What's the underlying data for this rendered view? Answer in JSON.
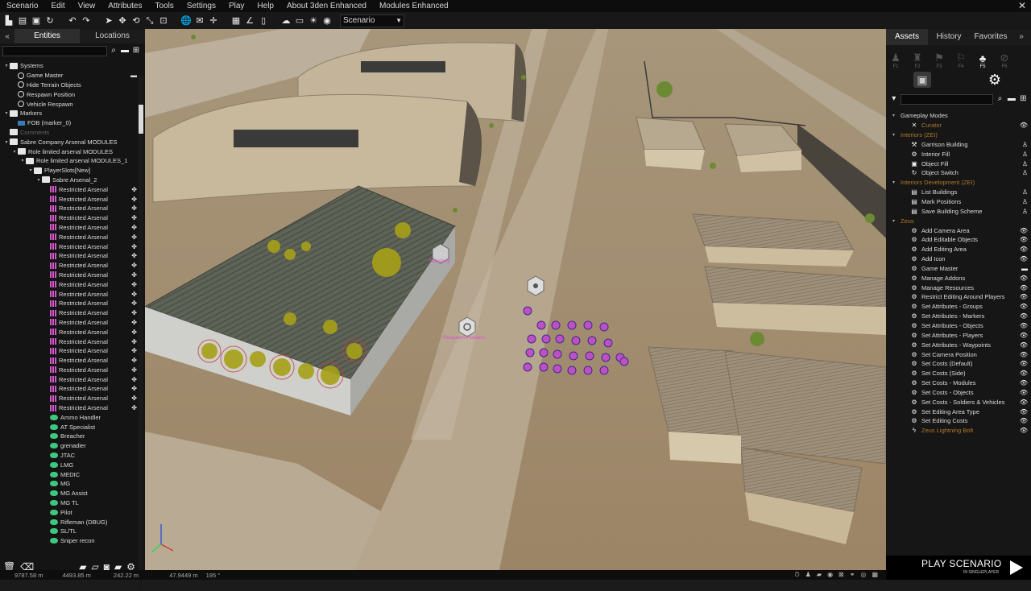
{
  "menu": [
    "Scenario",
    "Edit",
    "View",
    "Attributes",
    "Tools",
    "Settings",
    "Play",
    "Help",
    "About 3den Enhanced",
    "Modules Enhanced"
  ],
  "toolbar": {
    "scenario_select": "Scenario"
  },
  "left": {
    "tabs": [
      "Entities",
      "Locations"
    ],
    "tree": [
      {
        "label": "Systems",
        "indent": 0,
        "icon": "folder",
        "tog": "▾"
      },
      {
        "label": "Game Master",
        "indent": 1,
        "icon": "module",
        "tail": "▬"
      },
      {
        "label": "Hide Terrain Objects",
        "indent": 1,
        "icon": "module"
      },
      {
        "label": "Respawn Position",
        "indent": 1,
        "icon": "module"
      },
      {
        "label": "Vehicle Respawn",
        "indent": 1,
        "icon": "module"
      },
      {
        "label": "Markers",
        "indent": 0,
        "icon": "folder",
        "tog": "▾"
      },
      {
        "label": "FOB (marker_0)",
        "indent": 1,
        "icon": "marker"
      },
      {
        "label": "Comments",
        "indent": 0,
        "icon": "folder",
        "dim": true
      },
      {
        "label": "Sabre Company Arsenal MODULES",
        "indent": 0,
        "icon": "folder",
        "tog": "▾"
      },
      {
        "label": "Role limited arsenal MODULES",
        "indent": 1,
        "icon": "folder",
        "tog": "▾"
      },
      {
        "label": "Role limited arsenal MODULES_1",
        "indent": 2,
        "icon": "folder",
        "tog": "▾"
      },
      {
        "label": "PlayerSlots[New]",
        "indent": 3,
        "icon": "folder",
        "tog": "▾"
      },
      {
        "label": "Sabre Arsenal_2",
        "indent": 4,
        "icon": "folder",
        "tog": "▾"
      },
      {
        "label": "Restricted Arsenal",
        "indent": 5,
        "icon": "arsenal",
        "tail": "✤"
      },
      {
        "label": "Restricted Arsenal",
        "indent": 5,
        "icon": "arsenal",
        "tail": "✤"
      },
      {
        "label": "Restricted Arsenal",
        "indent": 5,
        "icon": "arsenal",
        "tail": "✤"
      },
      {
        "label": "Restricted Arsenal",
        "indent": 5,
        "icon": "arsenal",
        "tail": "✤"
      },
      {
        "label": "Restricted Arsenal",
        "indent": 5,
        "icon": "arsenal",
        "tail": "✤"
      },
      {
        "label": "Restricted Arsenal",
        "indent": 5,
        "icon": "arsenal",
        "tail": "✤"
      },
      {
        "label": "Restricted Arsenal",
        "indent": 5,
        "icon": "arsenal",
        "tail": "✤"
      },
      {
        "label": "Restricted Arsenal",
        "indent": 5,
        "icon": "arsenal",
        "tail": "✤"
      },
      {
        "label": "Restricted Arsenal",
        "indent": 5,
        "icon": "arsenal",
        "tail": "✤"
      },
      {
        "label": "Restricted Arsenal",
        "indent": 5,
        "icon": "arsenal",
        "tail": "✤"
      },
      {
        "label": "Restricted Arsenal",
        "indent": 5,
        "icon": "arsenal",
        "tail": "✤"
      },
      {
        "label": "Restricted Arsenal",
        "indent": 5,
        "icon": "arsenal",
        "tail": "✤"
      },
      {
        "label": "Restricted Arsenal",
        "indent": 5,
        "icon": "arsenal",
        "tail": "✤"
      },
      {
        "label": "Restricted Arsenal",
        "indent": 5,
        "icon": "arsenal",
        "tail": "✤"
      },
      {
        "label": "Restricted Arsenal",
        "indent": 5,
        "icon": "arsenal",
        "tail": "✤"
      },
      {
        "label": "Restricted Arsenal",
        "indent": 5,
        "icon": "arsenal",
        "tail": "✤"
      },
      {
        "label": "Restricted Arsenal",
        "indent": 5,
        "icon": "arsenal",
        "tail": "✤"
      },
      {
        "label": "Restricted Arsenal",
        "indent": 5,
        "icon": "arsenal",
        "tail": "✤"
      },
      {
        "label": "Restricted Arsenal",
        "indent": 5,
        "icon": "arsenal",
        "tail": "✤"
      },
      {
        "label": "Restricted Arsenal",
        "indent": 5,
        "icon": "arsenal",
        "tail": "✤"
      },
      {
        "label": "Restricted Arsenal",
        "indent": 5,
        "icon": "arsenal",
        "tail": "✤"
      },
      {
        "label": "Restricted Arsenal",
        "indent": 5,
        "icon": "arsenal",
        "tail": "✤"
      },
      {
        "label": "Restricted Arsenal",
        "indent": 5,
        "icon": "arsenal",
        "tail": "✤"
      },
      {
        "label": "Restricted Arsenal",
        "indent": 5,
        "icon": "arsenal",
        "tail": "✤"
      },
      {
        "label": "Ammo Handler",
        "indent": 5,
        "icon": "unit"
      },
      {
        "label": "AT Specialist",
        "indent": 5,
        "icon": "unit"
      },
      {
        "label": "Breacher",
        "indent": 5,
        "icon": "unit"
      },
      {
        "label": "grenadier",
        "indent": 5,
        "icon": "unit"
      },
      {
        "label": "JTAC",
        "indent": 5,
        "icon": "unit"
      },
      {
        "label": "LMG",
        "indent": 5,
        "icon": "unit"
      },
      {
        "label": "MEDIC",
        "indent": 5,
        "icon": "unit"
      },
      {
        "label": "MG",
        "indent": 5,
        "icon": "unit"
      },
      {
        "label": "MG Assist",
        "indent": 5,
        "icon": "unit"
      },
      {
        "label": "MG TL",
        "indent": 5,
        "icon": "unit"
      },
      {
        "label": "Pilot",
        "indent": 5,
        "icon": "unit"
      },
      {
        "label": "Rifleman (DBUG)",
        "indent": 5,
        "icon": "unit"
      },
      {
        "label": "SL/TL",
        "indent": 5,
        "icon": "unit"
      },
      {
        "label": "Sniper recon",
        "indent": 5,
        "icon": "unit"
      }
    ]
  },
  "right": {
    "tabs": [
      "Assets",
      "History",
      "Favorites"
    ],
    "fkeys": [
      "F1",
      "F2",
      "F3",
      "F4",
      "F5",
      "F6"
    ],
    "assets": [
      {
        "type": "cat",
        "label": "Gameplay Modes",
        "tog": "▾"
      },
      {
        "type": "leaf",
        "label": "Curator",
        "icon": "✕",
        "orange": true,
        "eye": "👁"
      },
      {
        "type": "cat",
        "label": "Interiors (ZEI)",
        "tog": "▾",
        "orange": true
      },
      {
        "type": "leaf",
        "label": "Garrison Building",
        "icon": "⚒",
        "eye": "♙"
      },
      {
        "type": "leaf",
        "label": "Interior Fill",
        "icon": "⚙",
        "eye": "♙"
      },
      {
        "type": "leaf",
        "label": "Object Fill",
        "icon": "▣",
        "eye": "♙"
      },
      {
        "type": "leaf",
        "label": "Object Switch",
        "icon": "↻",
        "eye": "♙"
      },
      {
        "type": "cat",
        "label": "Interiors Development (ZEI)",
        "tog": "▾",
        "orange": true
      },
      {
        "type": "leaf",
        "label": "List Buildings",
        "icon": "▤",
        "eye": "♙"
      },
      {
        "type": "leaf",
        "label": "Mark Positions",
        "icon": "▤",
        "eye": "♙"
      },
      {
        "type": "leaf",
        "label": "Save Building Scheme",
        "icon": "▤",
        "eye": "♙"
      },
      {
        "type": "cat",
        "label": "Zeus",
        "tog": "▾",
        "orange": true
      },
      {
        "type": "leaf",
        "label": "Add Camera Area",
        "icon": "⚙",
        "eye": "👁"
      },
      {
        "type": "leaf",
        "label": "Add Editable Objects",
        "icon": "⚙",
        "eye": "👁"
      },
      {
        "type": "leaf",
        "label": "Add Editing Area",
        "icon": "⚙",
        "eye": "👁"
      },
      {
        "type": "leaf",
        "label": "Add Icon",
        "icon": "⚙",
        "eye": "👁"
      },
      {
        "type": "leaf",
        "label": "Game Master",
        "icon": "⚙",
        "eye": "▬"
      },
      {
        "type": "leaf",
        "label": "Manage Addons",
        "icon": "⚙",
        "eye": "👁"
      },
      {
        "type": "leaf",
        "label": "Manage Resources",
        "icon": "⚙",
        "eye": "👁"
      },
      {
        "type": "leaf",
        "label": "Restrict Editing Around Players",
        "icon": "⚙",
        "eye": "👁"
      },
      {
        "type": "leaf",
        "label": "Set Attributes - Groups",
        "icon": "⚙",
        "eye": "👁"
      },
      {
        "type": "leaf",
        "label": "Set Attributes - Markers",
        "icon": "⚙",
        "eye": "👁"
      },
      {
        "type": "leaf",
        "label": "Set Attributes - Objects",
        "icon": "⚙",
        "eye": "👁"
      },
      {
        "type": "leaf",
        "label": "Set Attributes - Players",
        "icon": "⚙",
        "eye": "👁"
      },
      {
        "type": "leaf",
        "label": "Set Attributes - Waypoints",
        "icon": "⚙",
        "eye": "👁"
      },
      {
        "type": "leaf",
        "label": "Set Camera Position",
        "icon": "⚙",
        "eye": "👁"
      },
      {
        "type": "leaf",
        "label": "Set Costs (Default)",
        "icon": "⚙",
        "eye": "👁"
      },
      {
        "type": "leaf",
        "label": "Set Costs (Side)",
        "icon": "⚙",
        "eye": "👁"
      },
      {
        "type": "leaf",
        "label": "Set Costs - Modules",
        "icon": "⚙",
        "eye": "👁"
      },
      {
        "type": "leaf",
        "label": "Set Costs - Objects",
        "icon": "⚙",
        "eye": "👁"
      },
      {
        "type": "leaf",
        "label": "Set Costs - Soldiers & Vehicles",
        "icon": "⚙",
        "eye": "👁"
      },
      {
        "type": "leaf",
        "label": "Set Editing Area Type",
        "icon": "⚙",
        "eye": "👁"
      },
      {
        "type": "leaf",
        "label": "Set Editing Costs",
        "icon": "⚙",
        "eye": "👁"
      },
      {
        "type": "leaf",
        "label": "Zeus Lightning Bolt",
        "icon": "ϟ",
        "orange": true,
        "eye": "👁"
      }
    ]
  },
  "viewport": {
    "labels": {
      "sideshop": "Sideshop",
      "respawn": "Respawn Position"
    }
  },
  "play": {
    "title": "PLAY SCENARIO",
    "subtitle": "IN SINGLEPLAYER"
  },
  "status": [
    "9787.58 m",
    "4493.85 m",
    "242.22 m",
    "47.9449 m",
    "195 °"
  ]
}
